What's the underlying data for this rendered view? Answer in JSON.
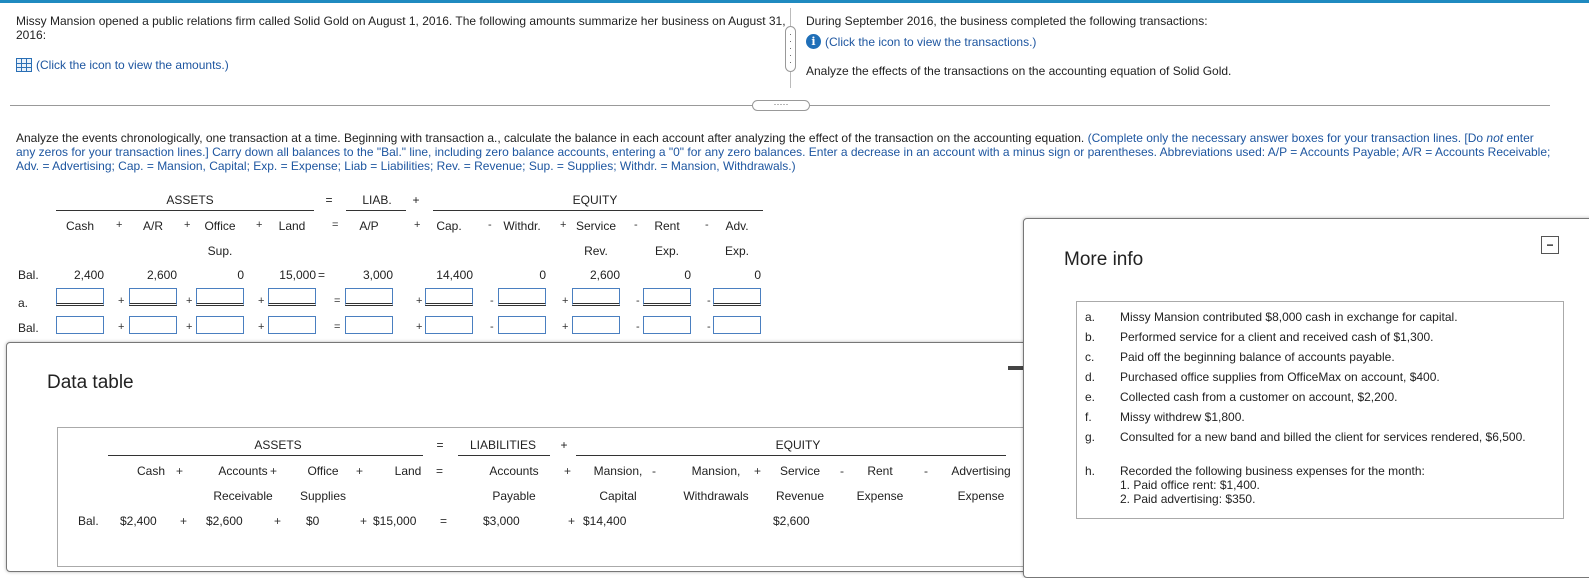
{
  "intro": {
    "left_text": "Missy Mansion opened a public relations firm called Solid Gold on August 1, 2016. The following amounts summarize her business on August 31, 2016:",
    "amounts_link": "(Click the icon to view the amounts.)",
    "right_text": "During September 2016, the business completed the following transactions:",
    "transactions_link": "(Click the icon to view the transactions.)",
    "analyze_text": "Analyze the effects of the transactions on the accounting equation of Solid Gold."
  },
  "instructions": {
    "part1": "Analyze the events chronologically, one transaction at a time. Beginning with transaction a., calculate the balance in each account after analyzing the effect of the transaction on the accounting equation.",
    "part2": " (Complete only the necessary answer boxes for your transaction lines. [Do ",
    "not": "not",
    "part3": " enter any zeros for your transaction lines.] Carry down all balances to the \"Bal.\" line, including zero balance accounts, entering a \"0\" for any zero balances. Enter a decrease in an account with a minus sign or parentheses. Abbreviations used: A/P = Accounts Payable; A/R = Accounts Receivable; Adv. = Advertising; Cap. = Mansion, Capital; Exp. = Expense; Liab = Liabilities; Rev. = Revenue; Sup. = Supplies; Withdr. = Mansion, Withdrawals.)"
  },
  "equation": {
    "assets": "ASSETS",
    "eq": "=",
    "liab": "LIAB.",
    "plus": "+",
    "equity": "EQUITY",
    "columns": [
      {
        "op": "",
        "l1": "Cash",
        "l2": ""
      },
      {
        "op": "+",
        "l1": "A/R",
        "l2": ""
      },
      {
        "op": "+",
        "l1": "Office",
        "l2": "Sup."
      },
      {
        "op": "+",
        "l1": "Land",
        "l2": ""
      },
      {
        "op": "=",
        "l1": "A/P",
        "l2": ""
      },
      {
        "op": "+",
        "l1": "Cap.",
        "l2": ""
      },
      {
        "op": "-",
        "l1": "Withdr.",
        "l2": ""
      },
      {
        "op": "+",
        "l1": "Service",
        "l2": "Rev."
      },
      {
        "op": "-",
        "l1": "Rent",
        "l2": "Exp."
      },
      {
        "op": "-",
        "l1": "Adv.",
        "l2": "Exp."
      }
    ],
    "bal_label": "Bal.",
    "balances": [
      "2,400",
      "2,600",
      "0",
      "15,000",
      "3,000",
      "14,400",
      "0",
      "2,600",
      "0",
      "0"
    ],
    "row_a_label": "a.",
    "row_bal2_label": "Bal.",
    "row_ops": [
      "",
      "+",
      "+",
      "+",
      "=",
      "+",
      "-",
      "+",
      "-",
      "-"
    ]
  },
  "data_table": {
    "title": "Data table",
    "assets": "ASSETS",
    "eq": "=",
    "liabilities": "LIABILITIES",
    "plus": "+",
    "equity": "EQUITY",
    "columns": [
      {
        "op": "",
        "l1": "Cash",
        "l2": ""
      },
      {
        "op": "+",
        "l1": "Accounts",
        "l2": "Receivable"
      },
      {
        "op": "+",
        "l1": "Office",
        "l2": "Supplies"
      },
      {
        "op": "+",
        "l1": "Land",
        "l2": ""
      },
      {
        "op": "=",
        "l1": "Accounts",
        "l2": "Payable"
      },
      {
        "op": "+",
        "l1": "Mansion,",
        "l2": "Capital"
      },
      {
        "op": "-",
        "l1": "Mansion,",
        "l2": "Withdrawals"
      },
      {
        "op": "+",
        "l1": "Service",
        "l2": "Revenue"
      },
      {
        "op": "-",
        "l1": "Rent",
        "l2": "Expense"
      },
      {
        "op": "-",
        "l1": "Advertising",
        "l2": "Expense"
      }
    ],
    "bal_label": "Bal.",
    "balances": [
      {
        "op": "",
        "v": "$2,400"
      },
      {
        "op": "+",
        "v": "$2,600"
      },
      {
        "op": "+",
        "v": "$0"
      },
      {
        "op": "+",
        "v": "$15,000"
      },
      {
        "op": "=",
        "v": "$3,000"
      },
      {
        "op": "+",
        "v": "$14,400"
      },
      {
        "op": "",
        "v": ""
      },
      {
        "op": "",
        "v": "$2,600"
      },
      {
        "op": "",
        "v": ""
      },
      {
        "op": "",
        "v": ""
      }
    ]
  },
  "more_info": {
    "title": "More info",
    "items": [
      {
        "letter": "a.",
        "text": "Missy Mansion contributed $8,000 cash in exchange for capital."
      },
      {
        "letter": "b.",
        "text": "Performed service for a client and received cash of $1,300."
      },
      {
        "letter": "c.",
        "text": "Paid off the beginning balance of accounts payable."
      },
      {
        "letter": "d.",
        "text": "Purchased office supplies from OfficeMax on account, $400."
      },
      {
        "letter": "e.",
        "text": "Collected cash from a customer on account, $2,200."
      },
      {
        "letter": "f.",
        "text": "Missy withdrew $1,800."
      },
      {
        "letter": "g.",
        "text": "Consulted for a new band and billed the client for services rendered, $6,500."
      },
      {
        "letter": "h.",
        "text": "Recorded the following business expenses for the month:",
        "sub": [
          "1. Paid office rent: $1,400.",
          "2. Paid advertising: $350."
        ]
      }
    ],
    "minimize": "−"
  }
}
